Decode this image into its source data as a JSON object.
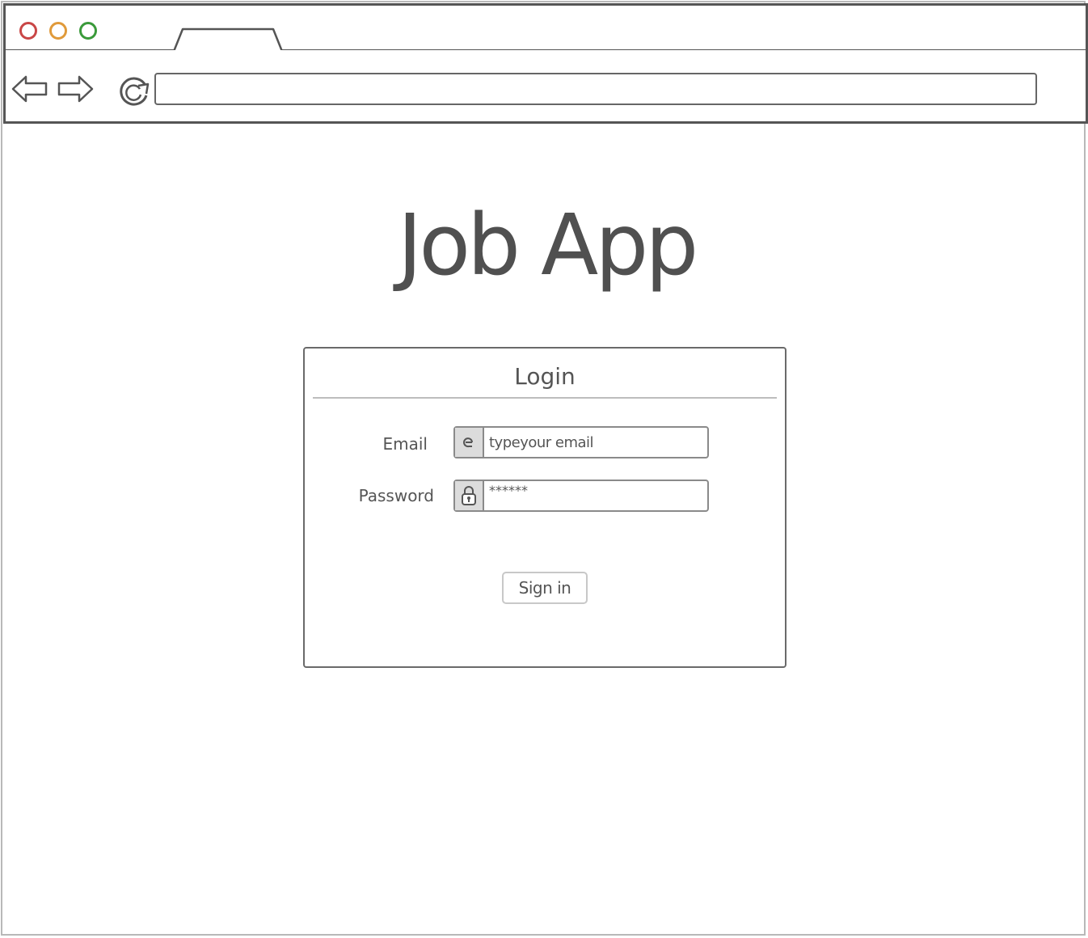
{
  "browser": {
    "address_value": "",
    "colors": {
      "close": "#c94646",
      "minimize": "#e09a3a",
      "maximize": "#3a9a3a",
      "chrome_border": "#555555"
    },
    "icons": {
      "back": "arrow-left-icon",
      "forward": "arrow-right-icon",
      "reload": "reload-icon"
    }
  },
  "page": {
    "app_title": "Job App"
  },
  "login": {
    "title": "Login",
    "email": {
      "label": "Email",
      "placeholder": "typeyour email",
      "value": "",
      "icon": "at-sign-icon"
    },
    "password": {
      "label": "Password",
      "value": "******",
      "icon": "lock-icon"
    },
    "submit_label": "Sign in"
  }
}
